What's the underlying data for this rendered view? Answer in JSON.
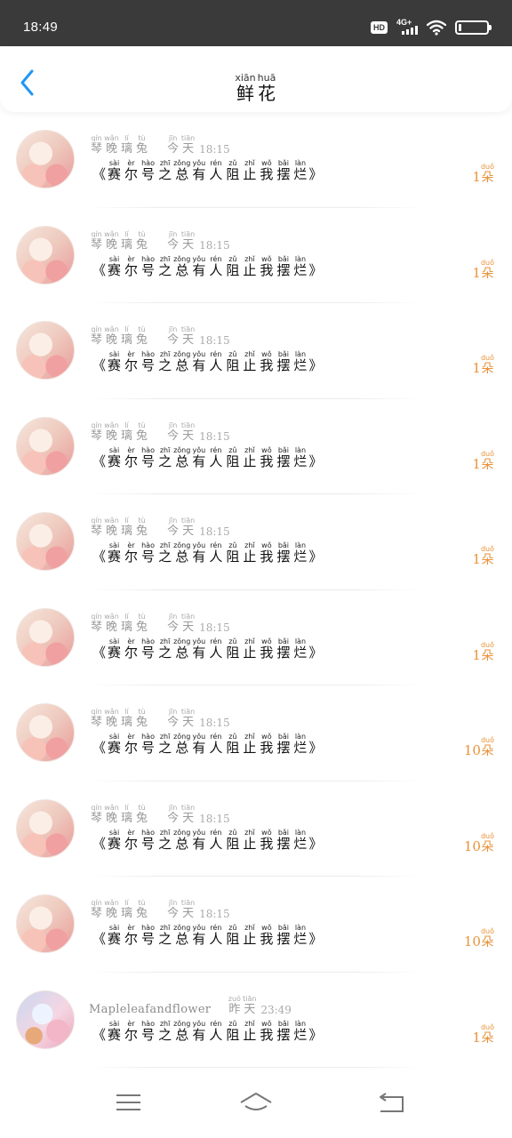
{
  "status": {
    "time": "18:49",
    "hd": "HD",
    "network": "4G+",
    "battery_level": 0.1
  },
  "header": {
    "back_icon": "chevron-left-icon",
    "title": [
      {
        "py": "xiān",
        "hz": "鲜"
      },
      {
        "py": "huā",
        "hz": "花"
      }
    ]
  },
  "colors": {
    "accent": "#2196f3",
    "count": "#e8923a"
  },
  "items": [
    {
      "avatar": "anime-girl-1",
      "name": [
        {
          "py": "qín",
          "hz": "琴"
        },
        {
          "py": "wǎn",
          "hz": "晚"
        },
        {
          "py": "lí",
          "hz": "璃"
        },
        {
          "py": "tù",
          "hz": "兔"
        }
      ],
      "day": [
        {
          "py": "jīn",
          "hz": "今"
        },
        {
          "py": "tiān",
          "hz": "天"
        }
      ],
      "clock": "18:15",
      "open": "《",
      "close": "》",
      "message": [
        {
          "py": "sài",
          "hz": "赛"
        },
        {
          "py": "èr",
          "hz": "尔"
        },
        {
          "py": "hào",
          "hz": "号"
        },
        {
          "py": "zhī",
          "hz": "之"
        },
        {
          "py": "zǒng",
          "hz": "总"
        },
        {
          "py": "yǒu",
          "hz": "有"
        },
        {
          "py": "rén",
          "hz": "人"
        },
        {
          "py": "zǔ",
          "hz": "阻"
        },
        {
          "py": "zhǐ",
          "hz": "止"
        },
        {
          "py": "wǒ",
          "hz": "我"
        },
        {
          "py": "bǎi",
          "hz": "摆"
        },
        {
          "py": "làn",
          "hz": "烂"
        }
      ],
      "count": "1",
      "unit": [
        {
          "py": "duǒ",
          "hz": "朵"
        }
      ]
    },
    {
      "avatar": "anime-girl-1",
      "name": [
        {
          "py": "qín",
          "hz": "琴"
        },
        {
          "py": "wǎn",
          "hz": "晚"
        },
        {
          "py": "lí",
          "hz": "璃"
        },
        {
          "py": "tù",
          "hz": "兔"
        }
      ],
      "day": [
        {
          "py": "jīn",
          "hz": "今"
        },
        {
          "py": "tiān",
          "hz": "天"
        }
      ],
      "clock": "18:15",
      "open": "《",
      "close": "》",
      "message": [
        {
          "py": "sài",
          "hz": "赛"
        },
        {
          "py": "èr",
          "hz": "尔"
        },
        {
          "py": "hào",
          "hz": "号"
        },
        {
          "py": "zhī",
          "hz": "之"
        },
        {
          "py": "zǒng",
          "hz": "总"
        },
        {
          "py": "yǒu",
          "hz": "有"
        },
        {
          "py": "rén",
          "hz": "人"
        },
        {
          "py": "zǔ",
          "hz": "阻"
        },
        {
          "py": "zhǐ",
          "hz": "止"
        },
        {
          "py": "wǒ",
          "hz": "我"
        },
        {
          "py": "bǎi",
          "hz": "摆"
        },
        {
          "py": "làn",
          "hz": "烂"
        }
      ],
      "count": "1",
      "unit": [
        {
          "py": "duǒ",
          "hz": "朵"
        }
      ]
    },
    {
      "avatar": "anime-girl-1",
      "name": [
        {
          "py": "qín",
          "hz": "琴"
        },
        {
          "py": "wǎn",
          "hz": "晚"
        },
        {
          "py": "lí",
          "hz": "璃"
        },
        {
          "py": "tù",
          "hz": "兔"
        }
      ],
      "day": [
        {
          "py": "jīn",
          "hz": "今"
        },
        {
          "py": "tiān",
          "hz": "天"
        }
      ],
      "clock": "18:15",
      "open": "《",
      "close": "》",
      "message": [
        {
          "py": "sài",
          "hz": "赛"
        },
        {
          "py": "èr",
          "hz": "尔"
        },
        {
          "py": "hào",
          "hz": "号"
        },
        {
          "py": "zhī",
          "hz": "之"
        },
        {
          "py": "zǒng",
          "hz": "总"
        },
        {
          "py": "yǒu",
          "hz": "有"
        },
        {
          "py": "rén",
          "hz": "人"
        },
        {
          "py": "zǔ",
          "hz": "阻"
        },
        {
          "py": "zhǐ",
          "hz": "止"
        },
        {
          "py": "wǒ",
          "hz": "我"
        },
        {
          "py": "bǎi",
          "hz": "摆"
        },
        {
          "py": "làn",
          "hz": "烂"
        }
      ],
      "count": "1",
      "unit": [
        {
          "py": "duǒ",
          "hz": "朵"
        }
      ]
    },
    {
      "avatar": "anime-girl-1",
      "name": [
        {
          "py": "qín",
          "hz": "琴"
        },
        {
          "py": "wǎn",
          "hz": "晚"
        },
        {
          "py": "lí",
          "hz": "璃"
        },
        {
          "py": "tù",
          "hz": "兔"
        }
      ],
      "day": [
        {
          "py": "jīn",
          "hz": "今"
        },
        {
          "py": "tiān",
          "hz": "天"
        }
      ],
      "clock": "18:15",
      "open": "《",
      "close": "》",
      "message": [
        {
          "py": "sài",
          "hz": "赛"
        },
        {
          "py": "èr",
          "hz": "尔"
        },
        {
          "py": "hào",
          "hz": "号"
        },
        {
          "py": "zhī",
          "hz": "之"
        },
        {
          "py": "zǒng",
          "hz": "总"
        },
        {
          "py": "yǒu",
          "hz": "有"
        },
        {
          "py": "rén",
          "hz": "人"
        },
        {
          "py": "zǔ",
          "hz": "阻"
        },
        {
          "py": "zhǐ",
          "hz": "止"
        },
        {
          "py": "wǒ",
          "hz": "我"
        },
        {
          "py": "bǎi",
          "hz": "摆"
        },
        {
          "py": "làn",
          "hz": "烂"
        }
      ],
      "count": "1",
      "unit": [
        {
          "py": "duǒ",
          "hz": "朵"
        }
      ]
    },
    {
      "avatar": "anime-girl-1",
      "name": [
        {
          "py": "qín",
          "hz": "琴"
        },
        {
          "py": "wǎn",
          "hz": "晚"
        },
        {
          "py": "lí",
          "hz": "璃"
        },
        {
          "py": "tù",
          "hz": "兔"
        }
      ],
      "day": [
        {
          "py": "jīn",
          "hz": "今"
        },
        {
          "py": "tiān",
          "hz": "天"
        }
      ],
      "clock": "18:15",
      "open": "《",
      "close": "》",
      "message": [
        {
          "py": "sài",
          "hz": "赛"
        },
        {
          "py": "èr",
          "hz": "尔"
        },
        {
          "py": "hào",
          "hz": "号"
        },
        {
          "py": "zhī",
          "hz": "之"
        },
        {
          "py": "zǒng",
          "hz": "总"
        },
        {
          "py": "yǒu",
          "hz": "有"
        },
        {
          "py": "rén",
          "hz": "人"
        },
        {
          "py": "zǔ",
          "hz": "阻"
        },
        {
          "py": "zhǐ",
          "hz": "止"
        },
        {
          "py": "wǒ",
          "hz": "我"
        },
        {
          "py": "bǎi",
          "hz": "摆"
        },
        {
          "py": "làn",
          "hz": "烂"
        }
      ],
      "count": "1",
      "unit": [
        {
          "py": "duǒ",
          "hz": "朵"
        }
      ]
    },
    {
      "avatar": "anime-girl-1",
      "name": [
        {
          "py": "qín",
          "hz": "琴"
        },
        {
          "py": "wǎn",
          "hz": "晚"
        },
        {
          "py": "lí",
          "hz": "璃"
        },
        {
          "py": "tù",
          "hz": "兔"
        }
      ],
      "day": [
        {
          "py": "jīn",
          "hz": "今"
        },
        {
          "py": "tiān",
          "hz": "天"
        }
      ],
      "clock": "18:15",
      "open": "《",
      "close": "》",
      "message": [
        {
          "py": "sài",
          "hz": "赛"
        },
        {
          "py": "èr",
          "hz": "尔"
        },
        {
          "py": "hào",
          "hz": "号"
        },
        {
          "py": "zhī",
          "hz": "之"
        },
        {
          "py": "zǒng",
          "hz": "总"
        },
        {
          "py": "yǒu",
          "hz": "有"
        },
        {
          "py": "rén",
          "hz": "人"
        },
        {
          "py": "zǔ",
          "hz": "阻"
        },
        {
          "py": "zhǐ",
          "hz": "止"
        },
        {
          "py": "wǒ",
          "hz": "我"
        },
        {
          "py": "bǎi",
          "hz": "摆"
        },
        {
          "py": "làn",
          "hz": "烂"
        }
      ],
      "count": "1",
      "unit": [
        {
          "py": "duǒ",
          "hz": "朵"
        }
      ]
    },
    {
      "avatar": "anime-girl-1",
      "name": [
        {
          "py": "qín",
          "hz": "琴"
        },
        {
          "py": "wǎn",
          "hz": "晚"
        },
        {
          "py": "lí",
          "hz": "璃"
        },
        {
          "py": "tù",
          "hz": "兔"
        }
      ],
      "day": [
        {
          "py": "jīn",
          "hz": "今"
        },
        {
          "py": "tiān",
          "hz": "天"
        }
      ],
      "clock": "18:15",
      "open": "《",
      "close": "》",
      "message": [
        {
          "py": "sài",
          "hz": "赛"
        },
        {
          "py": "èr",
          "hz": "尔"
        },
        {
          "py": "hào",
          "hz": "号"
        },
        {
          "py": "zhī",
          "hz": "之"
        },
        {
          "py": "zǒng",
          "hz": "总"
        },
        {
          "py": "yǒu",
          "hz": "有"
        },
        {
          "py": "rén",
          "hz": "人"
        },
        {
          "py": "zǔ",
          "hz": "阻"
        },
        {
          "py": "zhǐ",
          "hz": "止"
        },
        {
          "py": "wǒ",
          "hz": "我"
        },
        {
          "py": "bǎi",
          "hz": "摆"
        },
        {
          "py": "làn",
          "hz": "烂"
        }
      ],
      "count": "10",
      "unit": [
        {
          "py": "duǒ",
          "hz": "朵"
        }
      ]
    },
    {
      "avatar": "anime-girl-1",
      "name": [
        {
          "py": "qín",
          "hz": "琴"
        },
        {
          "py": "wǎn",
          "hz": "晚"
        },
        {
          "py": "lí",
          "hz": "璃"
        },
        {
          "py": "tù",
          "hz": "兔"
        }
      ],
      "day": [
        {
          "py": "jīn",
          "hz": "今"
        },
        {
          "py": "tiān",
          "hz": "天"
        }
      ],
      "clock": "18:15",
      "open": "《",
      "close": "》",
      "message": [
        {
          "py": "sài",
          "hz": "赛"
        },
        {
          "py": "èr",
          "hz": "尔"
        },
        {
          "py": "hào",
          "hz": "号"
        },
        {
          "py": "zhī",
          "hz": "之"
        },
        {
          "py": "zǒng",
          "hz": "总"
        },
        {
          "py": "yǒu",
          "hz": "有"
        },
        {
          "py": "rén",
          "hz": "人"
        },
        {
          "py": "zǔ",
          "hz": "阻"
        },
        {
          "py": "zhǐ",
          "hz": "止"
        },
        {
          "py": "wǒ",
          "hz": "我"
        },
        {
          "py": "bǎi",
          "hz": "摆"
        },
        {
          "py": "làn",
          "hz": "烂"
        }
      ],
      "count": "10",
      "unit": [
        {
          "py": "duǒ",
          "hz": "朵"
        }
      ]
    },
    {
      "avatar": "anime-girl-1",
      "name": [
        {
          "py": "qín",
          "hz": "琴"
        },
        {
          "py": "wǎn",
          "hz": "晚"
        },
        {
          "py": "lí",
          "hz": "璃"
        },
        {
          "py": "tù",
          "hz": "兔"
        }
      ],
      "day": [
        {
          "py": "jīn",
          "hz": "今"
        },
        {
          "py": "tiān",
          "hz": "天"
        }
      ],
      "clock": "18:15",
      "open": "《",
      "close": "》",
      "message": [
        {
          "py": "sài",
          "hz": "赛"
        },
        {
          "py": "èr",
          "hz": "尔"
        },
        {
          "py": "hào",
          "hz": "号"
        },
        {
          "py": "zhī",
          "hz": "之"
        },
        {
          "py": "zǒng",
          "hz": "总"
        },
        {
          "py": "yǒu",
          "hz": "有"
        },
        {
          "py": "rén",
          "hz": "人"
        },
        {
          "py": "zǔ",
          "hz": "阻"
        },
        {
          "py": "zhǐ",
          "hz": "止"
        },
        {
          "py": "wǒ",
          "hz": "我"
        },
        {
          "py": "bǎi",
          "hz": "摆"
        },
        {
          "py": "làn",
          "hz": "烂"
        }
      ],
      "count": "10",
      "unit": [
        {
          "py": "duǒ",
          "hz": "朵"
        }
      ]
    },
    {
      "avatar": "anime-girl-2",
      "name_plain": "Mapleleafandflower",
      "day": [
        {
          "py": "zuó",
          "hz": "昨"
        },
        {
          "py": "tiān",
          "hz": "天"
        }
      ],
      "clock": "23:49",
      "open": "《",
      "close": "》",
      "message": [
        {
          "py": "sài",
          "hz": "赛"
        },
        {
          "py": "èr",
          "hz": "尔"
        },
        {
          "py": "hào",
          "hz": "号"
        },
        {
          "py": "zhī",
          "hz": "之"
        },
        {
          "py": "zǒng",
          "hz": "总"
        },
        {
          "py": "yǒu",
          "hz": "有"
        },
        {
          "py": "rén",
          "hz": "人"
        },
        {
          "py": "zǔ",
          "hz": "阻"
        },
        {
          "py": "zhǐ",
          "hz": "止"
        },
        {
          "py": "wǒ",
          "hz": "我"
        },
        {
          "py": "bǎi",
          "hz": "摆"
        },
        {
          "py": "làn",
          "hz": "烂"
        }
      ],
      "count": "1",
      "unit": [
        {
          "py": "duǒ",
          "hz": "朵"
        }
      ]
    }
  ],
  "nav": {
    "menu_icon": "menu-icon",
    "home_icon": "home-icon",
    "back_icon": "back-icon"
  }
}
